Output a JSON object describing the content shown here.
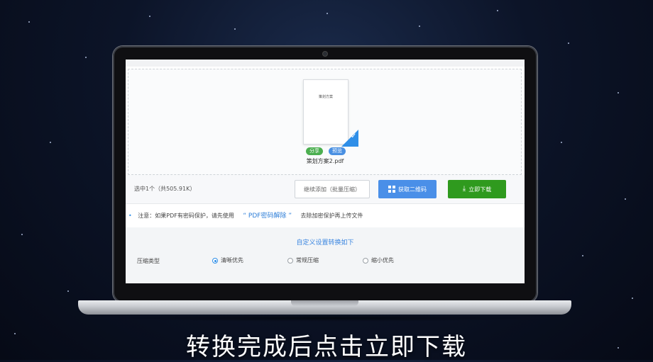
{
  "upload": {
    "thumbnail_title": "策划方案",
    "share_badge": "分享",
    "preview_badge": "预览",
    "filename": "策划方案2.pdf"
  },
  "actions": {
    "selected_info": "选中1个（共505.91K）",
    "add_button": "继续添加（批量压缩）",
    "qr_button": "获取二维码",
    "download_button": "立即下载"
  },
  "notice": {
    "prefix": "注意：如果PDF有密码保护，请先使用",
    "link": "“ PDF密码解除 ”",
    "suffix": "去除加密保护再上传文件"
  },
  "settings": {
    "title": "自定义设置转换如下",
    "compression_label": "压缩类型",
    "options": [
      {
        "label": "清晰优先",
        "selected": true
      },
      {
        "label": "常规压缩",
        "selected": false
      },
      {
        "label": "缩小优先",
        "selected": false
      }
    ]
  },
  "caption": "转换完成后点击立即下载",
  "colors": {
    "accent_blue": "#4a8fe8",
    "download_green": "#2f9a1e",
    "share_green": "#4caf50"
  }
}
